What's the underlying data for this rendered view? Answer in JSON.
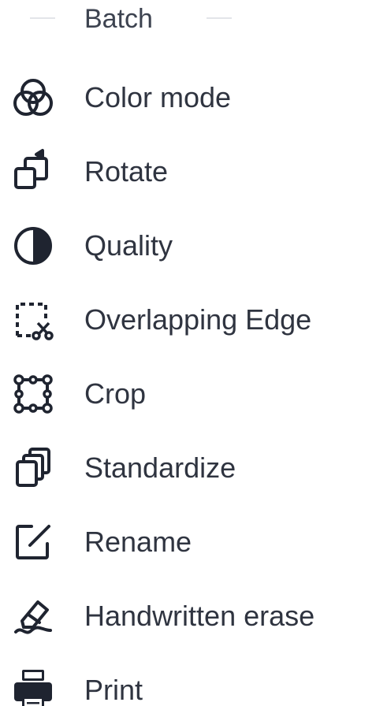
{
  "menu": {
    "header": "Batch",
    "items": [
      {
        "label": "Color mode",
        "icon": "color-mode-icon"
      },
      {
        "label": "Rotate",
        "icon": "rotate-icon"
      },
      {
        "label": "Quality",
        "icon": "quality-icon"
      },
      {
        "label": "Overlapping Edge",
        "icon": "overlapping-edge-icon"
      },
      {
        "label": "Crop",
        "icon": "crop-icon"
      },
      {
        "label": "Standardize",
        "icon": "standardize-icon"
      },
      {
        "label": "Rename",
        "icon": "rename-icon"
      },
      {
        "label": "Handwritten erase",
        "icon": "handwritten-erase-icon"
      },
      {
        "label": "Print",
        "icon": "print-icon"
      }
    ]
  },
  "colors": {
    "text": "#2f3440",
    "icon": "#1f2430",
    "divider": "#e3e5e9"
  }
}
